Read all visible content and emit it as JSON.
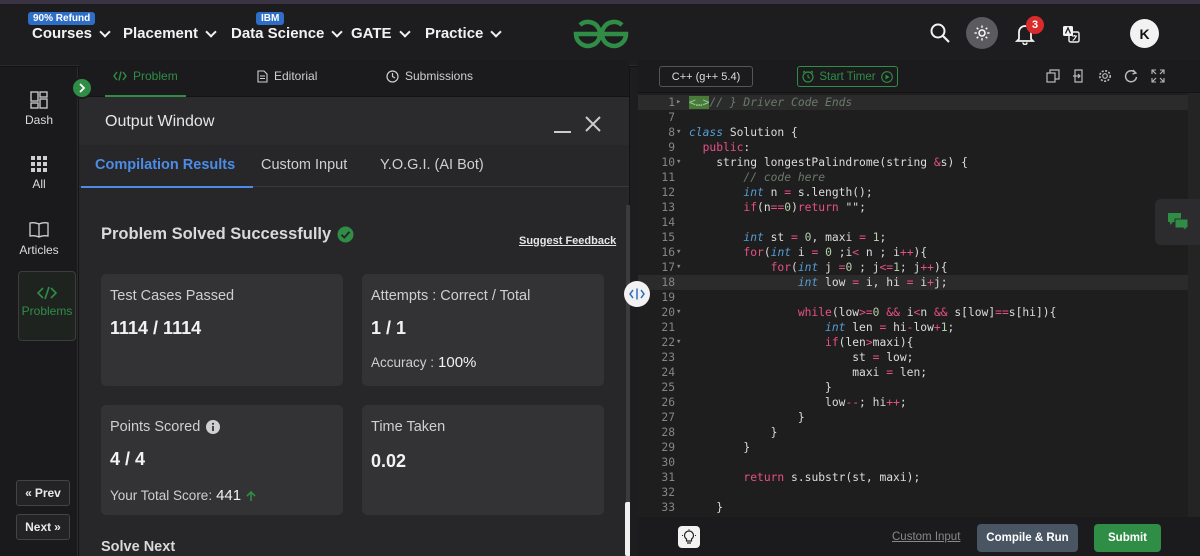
{
  "nav": {
    "items": [
      {
        "label": "Courses",
        "badge": "90% Refund"
      },
      {
        "label": "Placement"
      },
      {
        "label": "Data Science",
        "badge": "IBM"
      },
      {
        "label": "GATE"
      },
      {
        "label": "Practice"
      }
    ],
    "notification_count": "3",
    "avatar_letter": "K"
  },
  "rail": {
    "items": [
      {
        "label": "Dash"
      },
      {
        "label": "All"
      },
      {
        "label": "Articles"
      },
      {
        "label": "Problems"
      }
    ],
    "prev_label": "Prev",
    "next_label": "Next"
  },
  "problem_tabs": [
    {
      "label": "Problem"
    },
    {
      "label": "Editorial"
    },
    {
      "label": "Submissions"
    }
  ],
  "output_window": {
    "title": "Output Window",
    "tabs": [
      {
        "label": "Compilation Results"
      },
      {
        "label": "Custom Input"
      },
      {
        "label": "Y.O.G.I. (AI Bot)"
      }
    ],
    "status": "Problem Solved Successfully",
    "feedback_link": "Suggest Feedback",
    "cards": {
      "test_cases": {
        "title": "Test Cases Passed",
        "value": "1114 / 1114"
      },
      "attempts": {
        "title": "Attempts : Correct / Total",
        "value": "1 / 1",
        "sub_label": "Accuracy :",
        "sub_value": "100%"
      },
      "points": {
        "title": "Points Scored",
        "value": "4 / 4",
        "sub_label": "Your Total Score:",
        "sub_value": "441"
      },
      "time": {
        "title": "Time Taken",
        "value": "0.02"
      }
    },
    "solve_next": "Solve Next"
  },
  "editor": {
    "language": "C++ (g++ 5.4)",
    "timer_label": "Start Timer",
    "custom_input": "Custom Input",
    "compile_label": "Compile & Run",
    "submit_label": "Submit",
    "line_numbers": [
      "1",
      "7",
      "8",
      "9",
      "10",
      "11",
      "12",
      "13",
      "14",
      "15",
      "16",
      "17",
      "18",
      "19",
      "20",
      "21",
      "22",
      "23",
      "24",
      "25",
      "26",
      "27",
      "28",
      "29",
      "30",
      "31",
      "32",
      "33"
    ]
  },
  "colors": {
    "brand_green": "#2f8d46",
    "tab_blue": "#4d8ce6",
    "alert_red": "#d92b2b"
  }
}
